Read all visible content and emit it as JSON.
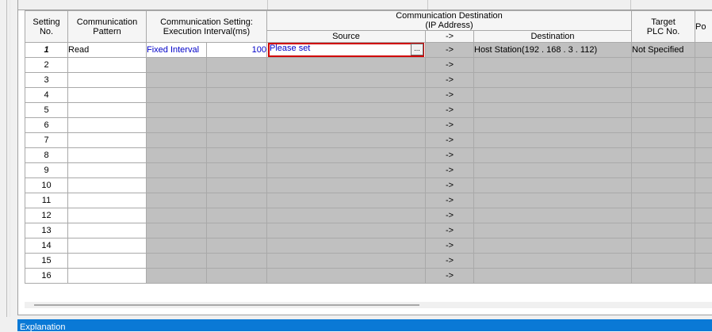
{
  "headers": {
    "setting_no": "Setting\nNo.",
    "comm_pattern": "Communication\nPattern",
    "comm_setting": "Communication Setting:\nExecution Interval(ms)",
    "comm_dest": "Communication Destination\n(IP Address)",
    "source": "Source",
    "arrow": "->",
    "destination": "Destination",
    "target_plc": "Target\nPLC No.",
    "port_partial": "Po"
  },
  "rows": [
    {
      "no": "1",
      "pattern": "Read",
      "interval_type": "Fixed Interval",
      "interval": "100",
      "source": "Please set",
      "button": "...",
      "arrow": "->",
      "destination": "Host Station(192 . 168 .   3 . 112)",
      "target": "Not Specified"
    },
    {
      "no": "2",
      "arrow": "->"
    },
    {
      "no": "3",
      "arrow": "->"
    },
    {
      "no": "4",
      "arrow": "->"
    },
    {
      "no": "5",
      "arrow": "->"
    },
    {
      "no": "6",
      "arrow": "->"
    },
    {
      "no": "7",
      "arrow": "->"
    },
    {
      "no": "8",
      "arrow": "->"
    },
    {
      "no": "9",
      "arrow": "->"
    },
    {
      "no": "10",
      "arrow": "->"
    },
    {
      "no": "11",
      "arrow": "->"
    },
    {
      "no": "12",
      "arrow": "->"
    },
    {
      "no": "13",
      "arrow": "->"
    },
    {
      "no": "14",
      "arrow": "->"
    },
    {
      "no": "15",
      "arrow": "->"
    },
    {
      "no": "16",
      "arrow": "->"
    }
  ],
  "footer": {
    "title": "Explanation"
  },
  "colors": {
    "highlight": "#d00000",
    "footer_bg": "#0a79d6",
    "link_text": "#0000c8",
    "disabled_cell": "#c0c0c0"
  }
}
